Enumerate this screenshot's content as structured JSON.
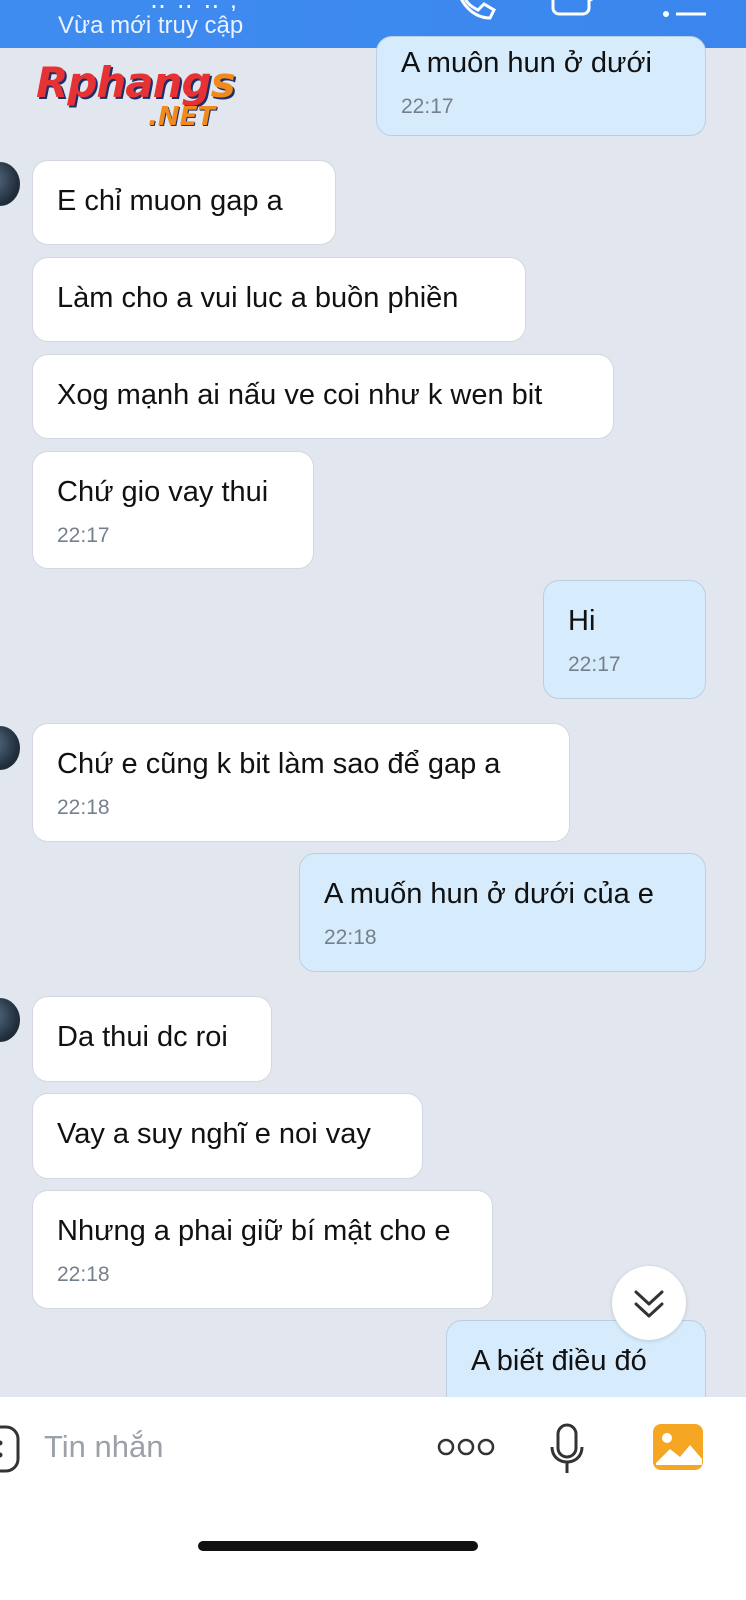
{
  "header": {
    "title_partial": "‥ ‥ ‥ ,",
    "subtitle": "Vừa mới truy cập"
  },
  "watermark": {
    "line1": "Rphangs",
    "line2": ".NET"
  },
  "messages": [
    {
      "side": "sent",
      "text": "A muôn hun ở dưới",
      "time": "22:17"
    },
    {
      "side": "recv",
      "text": "E chỉ muon gap a"
    },
    {
      "side": "recv",
      "text": "Làm cho a vui luc a buồn phiền"
    },
    {
      "side": "recv",
      "text": "Xog mạnh ai nấu ve coi như k wen bit"
    },
    {
      "side": "recv",
      "text": "Chứ gio vay thui",
      "time": "22:17"
    },
    {
      "side": "sent",
      "text": "Hi",
      "time": "22:17"
    },
    {
      "side": "recv",
      "text": "Chứ e cũng k bit làm sao để gap a",
      "time": "22:18"
    },
    {
      "side": "sent",
      "text": "A muốn hun ở dưới của e",
      "time": "22:18"
    },
    {
      "side": "recv",
      "text": "Da thui dc roi"
    },
    {
      "side": "recv",
      "text": "Vay a suy nghĩ e noi vay"
    },
    {
      "side": "recv",
      "text": "Nhưng a phai giữ bí mật cho e",
      "time": "22:18"
    },
    {
      "side": "sent",
      "text": "A biết điều đó"
    }
  ],
  "composer": {
    "placeholder": "Tin nhắn"
  },
  "icons": {
    "header": [
      "phone-icon",
      "video-call-icon",
      "menu-icon"
    ],
    "composer": [
      "sticker-icon",
      "more-icon",
      "microphone-icon",
      "image-icon"
    ],
    "scroll": "chevron-double-down-icon"
  },
  "colors": {
    "header": "#3f8cf0",
    "background": "#e2e7ef",
    "sent_bubble": "#d6ebfb",
    "recv_bubble": "#ffffff",
    "image_icon": "#f5a623"
  }
}
